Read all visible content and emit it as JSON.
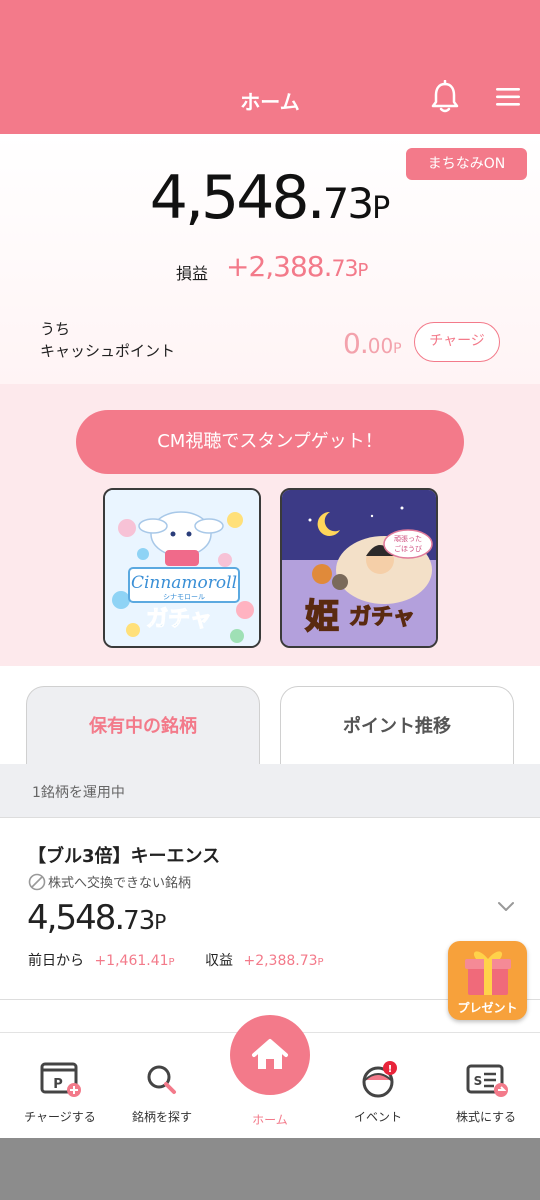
{
  "header": {
    "title": "ホーム"
  },
  "balance": {
    "badge": "まちなみON",
    "total_main": "4,548.",
    "total_decimal": "73",
    "total_unit": "P",
    "profit_label": "損益",
    "profit_main": "+2,388.",
    "profit_decimal": "73",
    "profit_unit": "P"
  },
  "cash": {
    "label_line1": "うち",
    "label_line2": "キャッシュポイント",
    "value_main": "0.",
    "value_decimal": "00",
    "value_unit": "P",
    "charge_button": "チャージ"
  },
  "promo": {
    "cm_button": "CM視聴でスタンプゲット！",
    "gacha_cards": [
      {
        "name": "Cinnamoroll",
        "subtitle": "シナモロール",
        "label": "ガチャ"
      },
      {
        "title": "姫",
        "label": "ガチャ",
        "bubble": "頑張ったごほうび"
      }
    ]
  },
  "tabs": [
    {
      "label": "保有中の銘柄",
      "active": true
    },
    {
      "label": "ポイント推移",
      "active": false
    }
  ],
  "holdings": {
    "operating_text": "1銘柄を運用中",
    "items": [
      {
        "name": "【ブル3倍】キーエンス",
        "note": "株式へ交換できない銘柄",
        "value_main": "4,548.",
        "value_decimal": "73",
        "value_unit": "P",
        "day_label": "前日から",
        "day_change": "+1,461.41",
        "day_unit": "P",
        "profit_label": "収益",
        "profit_value": "+2,388.73",
        "profit_unit": "P"
      }
    ]
  },
  "present_button": "プレゼント",
  "bottom_nav": [
    {
      "label": "チャージする",
      "icon": "charge-icon"
    },
    {
      "label": "銘柄を探す",
      "icon": "search-icon"
    },
    {
      "label": "ホーム",
      "icon": "home-icon"
    },
    {
      "label": "イベント",
      "icon": "event-icon"
    },
    {
      "label": "株式にする",
      "icon": "stock-icon"
    }
  ],
  "colors": {
    "accent": "#f37a8a",
    "accent_light": "#fde9ec"
  }
}
